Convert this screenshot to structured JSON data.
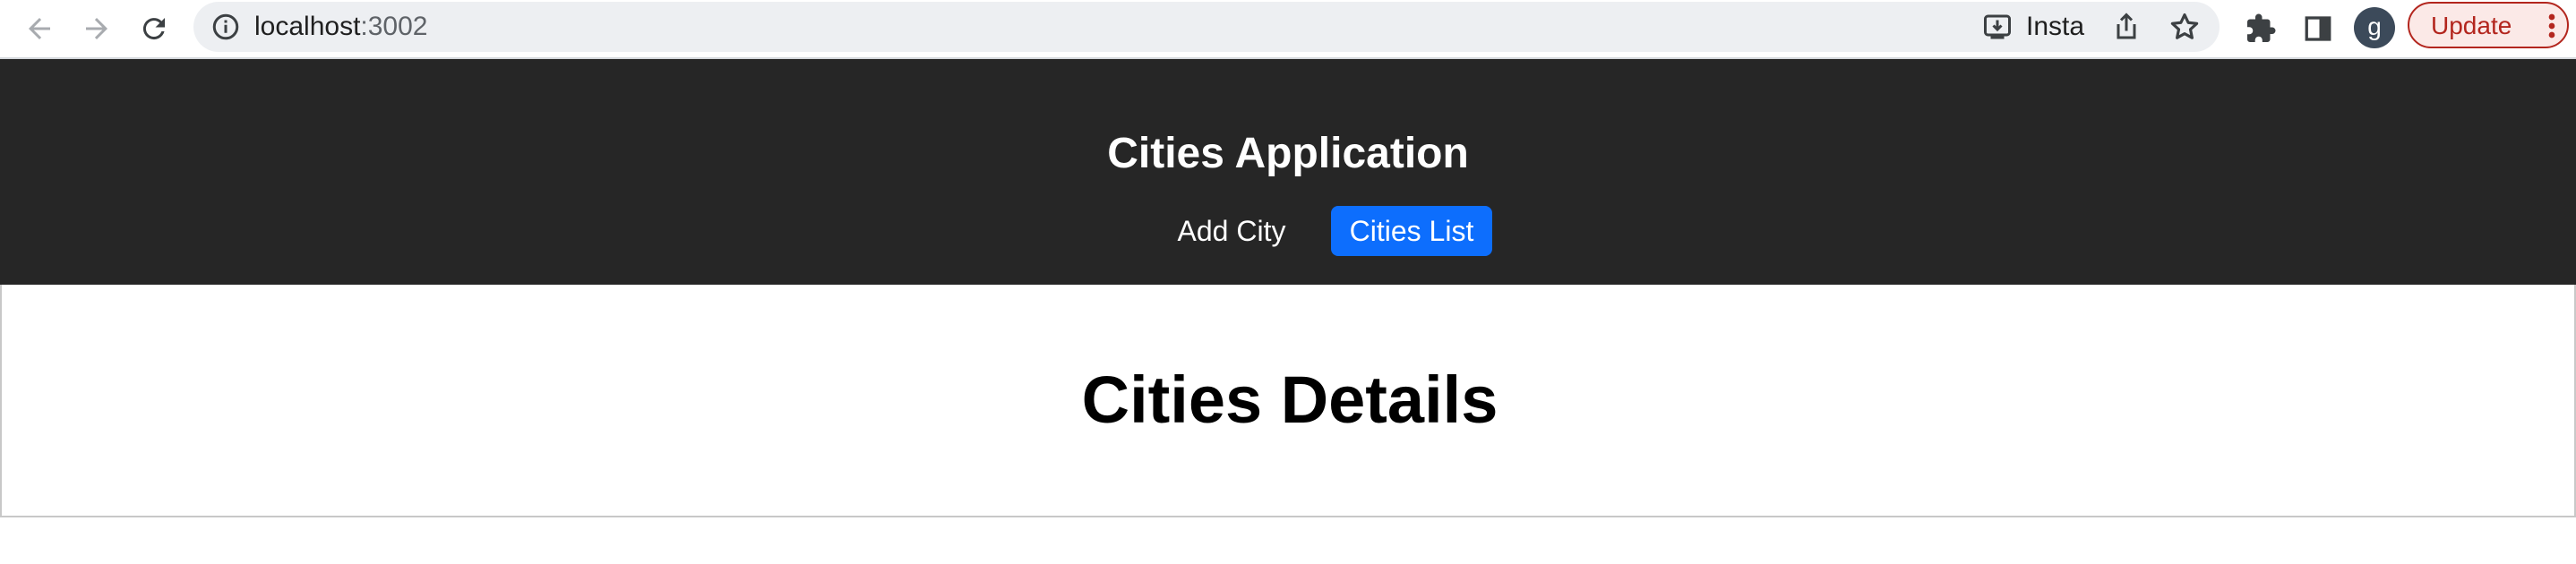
{
  "browser": {
    "url_host": "localhost",
    "url_port": ":3002",
    "extension_label": "Insta",
    "profile_initial": "g",
    "update_label": "Update",
    "icons": [
      "back-arrow-icon",
      "forward-arrow-icon",
      "reload-icon",
      "site-info-icon",
      "install-app-icon",
      "share-icon",
      "bookmark-star-icon",
      "extensions-puzzle-icon",
      "side-panel-icon",
      "more-vert-icon"
    ]
  },
  "app": {
    "title": "Cities Application",
    "nav": [
      {
        "label": "Add City",
        "active": false
      },
      {
        "label": "Cities List",
        "active": true
      }
    ],
    "active_color": "#0d6efd",
    "header_bg": "#262626"
  },
  "main": {
    "title": "Cities Details"
  }
}
